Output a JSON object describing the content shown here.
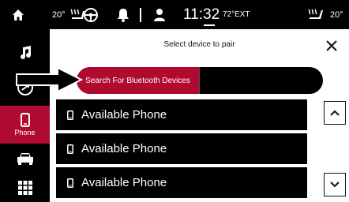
{
  "status_bar": {
    "left_temp": "20°",
    "clock": "11:32",
    "outside_temp": "72°EXT",
    "right_temp": "20°"
  },
  "sidebar": {
    "items": [
      {
        "icon": "music-icon"
      },
      {
        "icon": "media-icon"
      },
      {
        "icon": "phone-icon",
        "label": "Phone",
        "active": true
      },
      {
        "icon": "car-icon"
      },
      {
        "icon": "apps-grid-icon"
      }
    ]
  },
  "dialog": {
    "title": "Select device to pair",
    "search_label": "Search For Bluetooth Devices",
    "devices": [
      {
        "name": "Available Phone"
      },
      {
        "name": "Available Phone"
      },
      {
        "name": "Available Phone"
      }
    ]
  },
  "colors": {
    "accent": "#b00a30",
    "background": "#000000"
  }
}
